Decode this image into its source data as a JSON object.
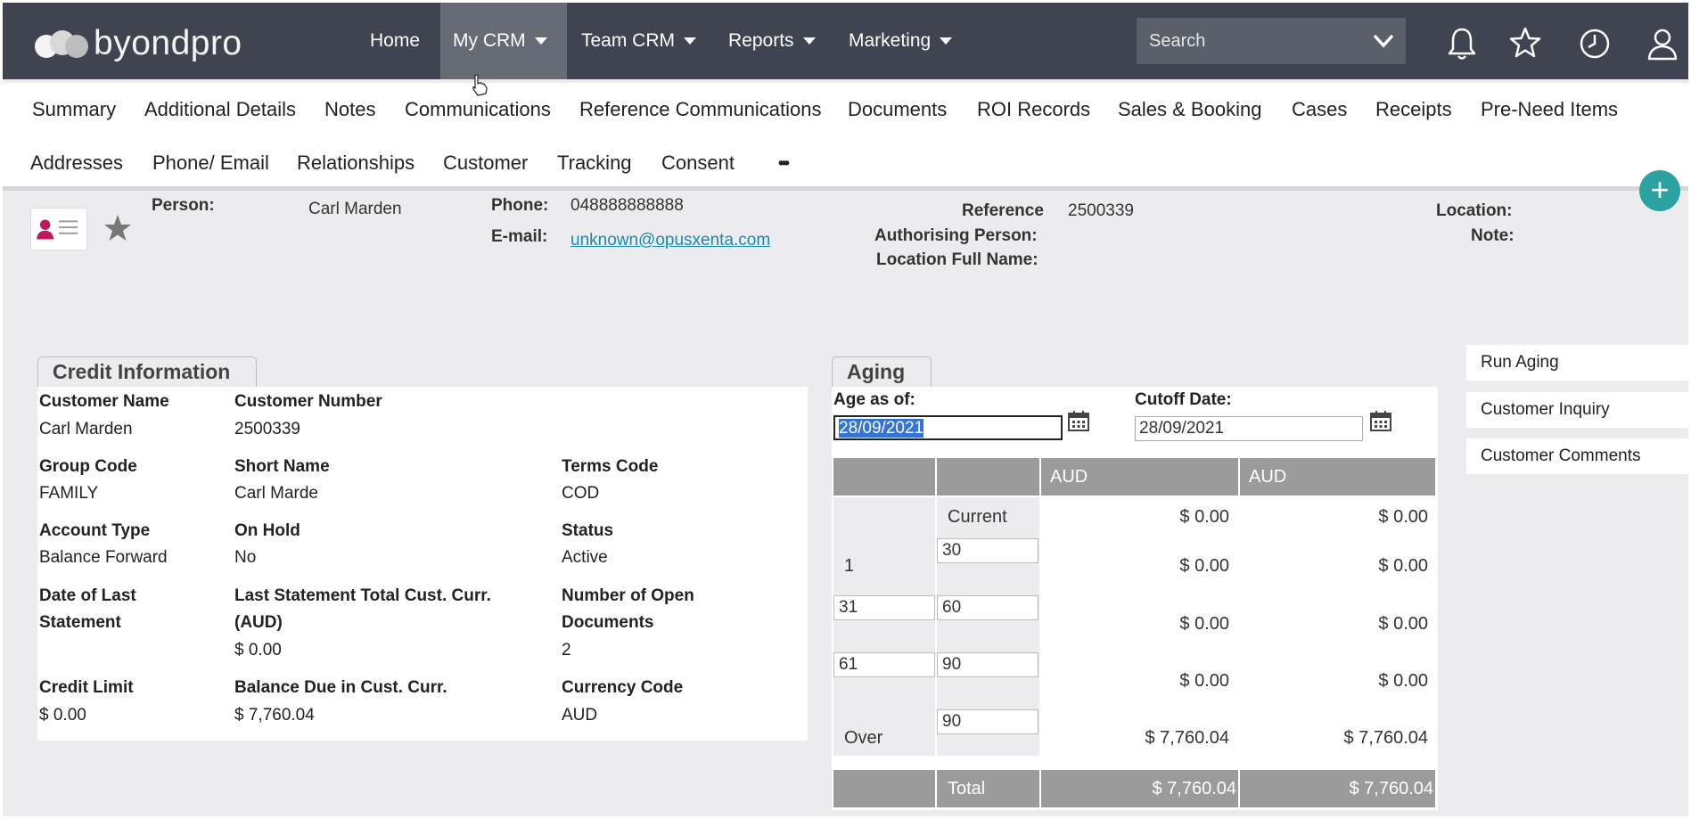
{
  "brand": {
    "name": "byondpro"
  },
  "topnav": {
    "items": [
      {
        "label": "Home",
        "caret": false
      },
      {
        "label": "My CRM",
        "caret": true
      },
      {
        "label": "Team CRM",
        "caret": true
      },
      {
        "label": "Reports",
        "caret": true
      },
      {
        "label": "Marketing",
        "caret": true
      }
    ],
    "search_placeholder": "Search"
  },
  "tabs_row1": [
    "Summary",
    "Additional Details",
    "Notes",
    "Communications",
    "Reference Communications",
    "Documents",
    "ROI Records",
    "Sales & Booking",
    "Cases",
    "Receipts",
    "Pre-Need Items"
  ],
  "tabs_row2": [
    "Addresses",
    "Phone/ Email",
    "Relationships",
    "Customer",
    "Tracking",
    "Consent",
    "•••"
  ],
  "header": {
    "person_label": "Person:",
    "person_value": "Carl Marden",
    "phone_label": "Phone:",
    "phone_value": "048888888888",
    "email_label": "E-mail:",
    "email_value": "unknown@opusxenta.com",
    "reference_label": "Reference",
    "reference_value": "2500339",
    "authorising_label": "Authorising Person:",
    "location_full_label": "Location Full Name:",
    "location_label": "Location:",
    "note_label": "Note:"
  },
  "credit": {
    "title": "Credit Information",
    "customer_name_label": "Customer Name",
    "customer_name": "Carl Marden",
    "customer_number_label": "Customer Number",
    "customer_number": "2500339",
    "group_code_label": "Group Code",
    "group_code": "FAMILY",
    "short_name_label": "Short Name",
    "short_name": "Carl Marde",
    "terms_code_label": "Terms Code",
    "terms_code": "COD",
    "account_type_label": "Account Type",
    "account_type": "Balance Forward",
    "on_hold_label": "On Hold",
    "on_hold": "No",
    "status_label": "Status",
    "status": "Active",
    "last_statement_date_label_1": "Date of Last",
    "last_statement_date_label_2": "Statement",
    "last_statement_total_label_1": "Last Statement Total Cust. Curr.",
    "last_statement_total_label_2": "(AUD)",
    "last_statement_total": "$ 0.00",
    "open_docs_label_1": "Number of Open",
    "open_docs_label_2": "Documents",
    "open_docs": "2",
    "credit_limit_label": "Credit Limit",
    "credit_limit": "$ 0.00",
    "balance_due_label": "Balance Due in Cust. Curr.",
    "balance_due": "$ 7,760.04",
    "currency_code_label": "Currency Code",
    "currency_code": "AUD"
  },
  "aging": {
    "title": "Aging",
    "age_as_of_label": "Age as of:",
    "age_as_of": "28/09/2021",
    "cutoff_label": "Cutoff Date:",
    "cutoff": "28/09/2021",
    "col_headers": [
      "AUD",
      "AUD"
    ],
    "rows": [
      {
        "from": "",
        "to": "",
        "label": "Current",
        "v1": "$ 0.00",
        "v2": "$ 0.00"
      },
      {
        "from": "1",
        "to": "30",
        "label": "",
        "v1": "$ 0.00",
        "v2": "$ 0.00"
      },
      {
        "from": "31",
        "to": "60",
        "label": "",
        "v1": "$ 0.00",
        "v2": "$ 0.00"
      },
      {
        "from": "61",
        "to": "90",
        "label": "",
        "v1": "$ 0.00",
        "v2": "$ 0.00"
      },
      {
        "from": "Over",
        "to": "90",
        "label": "",
        "v1": "$ 7,760.04",
        "v2": "$ 7,760.04"
      }
    ],
    "total_label": "Total",
    "total_v1": "$ 7,760.04",
    "total_v2": "$ 7,760.04"
  },
  "side_actions": [
    "Run Aging",
    "Customer Inquiry",
    "Customer Comments"
  ],
  "colors": {
    "topbar": "#3f4450",
    "accent": "#1a93c2",
    "plus": "#2aa3a0",
    "link": "#1a8ab0",
    "grid_header": "#9b9b9b"
  }
}
